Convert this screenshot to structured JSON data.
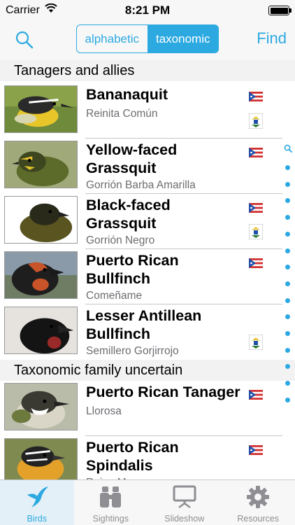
{
  "status_bar": {
    "carrier": "Carrier",
    "time": "8:21 PM"
  },
  "nav": {
    "search_icon": "search-icon",
    "segments": [
      {
        "label": "alphabetic",
        "active": false
      },
      {
        "label": "taxonomic",
        "active": true
      }
    ],
    "find_label": "Find"
  },
  "sections": [
    {
      "title": "Tanagers and allies"
    },
    {
      "title": "Taxonomic family uncertain"
    }
  ],
  "birds": [
    {
      "name": "Bananaquit",
      "spanish": "Reinita Común",
      "flags": [
        "pr",
        "vi"
      ]
    },
    {
      "name": "Yellow-faced Grassquit",
      "spanish": "Gorrión Barba Amarilla",
      "flags": [
        "pr"
      ]
    },
    {
      "name": "Black-faced Grassquit",
      "spanish": "Gorrión Negro",
      "flags": [
        "pr",
        "vi"
      ]
    },
    {
      "name": "Puerto Rican Bullfinch",
      "spanish": "Comeñame",
      "flags": [
        "pr"
      ]
    },
    {
      "name": "Lesser Antillean Bullfinch",
      "spanish": "Semillero Gorjirrojo",
      "flags": [
        "vi"
      ]
    },
    {
      "name": "Puerto Rican Tanager",
      "spanish": "Llorosa",
      "flags": [
        "pr"
      ]
    },
    {
      "name": "Puerto Rican Spindalis",
      "spanish": "Reina Mora",
      "flags": [
        "pr"
      ]
    }
  ],
  "index_bar": {
    "dot_count": 15
  },
  "tabs": [
    {
      "label": "Birds",
      "icon": "bird-icon",
      "active": true
    },
    {
      "label": "Sightings",
      "icon": "binoculars-icon",
      "active": false
    },
    {
      "label": "Slideshow",
      "icon": "projector-icon",
      "active": false
    },
    {
      "label": "Resources",
      "icon": "gear-icon",
      "active": false
    }
  ],
  "colors": {
    "accent": "#2ca9e1",
    "header_bg": "#f2f2f2",
    "bar_bg": "#f7f7f7",
    "subtitle": "#6d6d72"
  }
}
